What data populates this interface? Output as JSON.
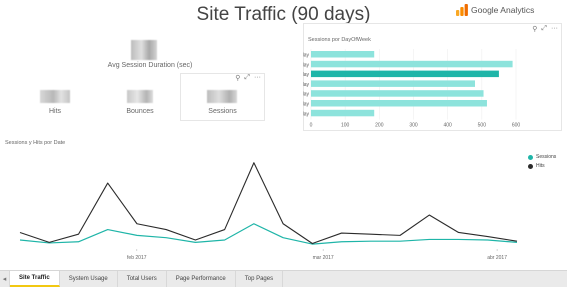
{
  "title": "Site Traffic (90 days)",
  "brand": {
    "name": "Google Analytics",
    "logo_color": "#f57c00"
  },
  "kpis": {
    "avg_session_duration_label": "Avg Session Duration (sec)",
    "hits_label": "Hits",
    "bounces_label": "Bounces",
    "sessions_label": "Sessions"
  },
  "card_toolbar": {
    "pin": "⚲",
    "expand": "⤢",
    "more": "···"
  },
  "bar_chart_title": "Sessions por DayOfWeek",
  "line_chart_title": "Sessions y Hits por Date",
  "line_legend": [
    "Sessions",
    "Hits"
  ],
  "tabs": [
    "Site Traffic",
    "System Usage",
    "Total Users",
    "Page Performance",
    "Top Pages"
  ],
  "active_tab_index": 0,
  "tab_prev_glyph": "◂",
  "colors": {
    "teal": "#1fb5a8",
    "teal_light": "#8de3dc",
    "dark": "#2b2b2b",
    "grid": "#eeeeee"
  },
  "chart_data": [
    {
      "type": "bar",
      "orientation": "horizontal",
      "title": "Sessions por DayOfWeek",
      "categories": [
        "Sunday",
        "Monday",
        "Tuesday",
        "Wednesday",
        "Thursday",
        "Friday",
        "Saturday"
      ],
      "values": [
        185,
        590,
        550,
        480,
        505,
        515,
        185
      ],
      "highlighted_category": "Tuesday",
      "xlim": [
        0,
        600
      ],
      "xticks": [
        "0",
        "100",
        "200",
        "300",
        "400",
        "500",
        "600"
      ],
      "grid": true
    },
    {
      "type": "line",
      "title": "Sessions y Hits por Date",
      "x_ticks": [
        "feb 2017",
        "mar 2017",
        "abr 2017"
      ],
      "series": [
        {
          "name": "Sessions",
          "values": [
            12,
            7,
            9,
            30,
            20,
            16,
            8,
            12,
            40,
            16,
            5,
            9,
            10,
            10,
            13,
            13,
            12,
            8
          ]
        },
        {
          "name": "Hits",
          "values": [
            25,
            8,
            22,
            110,
            40,
            30,
            12,
            30,
            145,
            40,
            6,
            24,
            22,
            20,
            55,
            25,
            18,
            10
          ]
        }
      ],
      "ylim": [
        0,
        160
      ],
      "legend": "top-right"
    }
  ]
}
